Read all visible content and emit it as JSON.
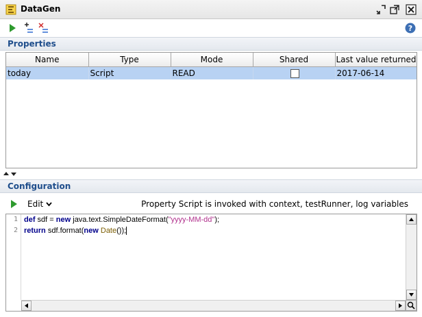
{
  "window": {
    "title": "DataGen",
    "icons": [
      "datagen-icon",
      "minimize-icon",
      "maximize-icon",
      "close-icon"
    ]
  },
  "toolbar": {
    "buttons": [
      "run-icon",
      "add-property-icon",
      "remove-property-icon",
      "help-icon"
    ]
  },
  "properties": {
    "header": "Properties",
    "columns": [
      "Name",
      "Type",
      "Mode",
      "Shared",
      "Last value returned"
    ],
    "rows": [
      {
        "name": "today",
        "type": "Script",
        "mode": "READ",
        "shared": false,
        "last_value": "2017-06-14",
        "selected": true
      }
    ]
  },
  "configuration": {
    "header": "Configuration",
    "edit_label": "Edit",
    "info": "Property Script is invoked with context, testRunner, log variables",
    "code_lines": [
      "def sdf = new java.text.SimpleDateFormat(\"yyyy-MM-dd\");",
      "return sdf.format(new Date());"
    ],
    "line_numbers": [
      "1",
      "2"
    ]
  },
  "colors": {
    "section_header_text": "#1f4e8c",
    "selection": "#b8d2f3",
    "keyword": "#00008b",
    "string": "#b0308c",
    "run_green": "#2e9a2e"
  }
}
